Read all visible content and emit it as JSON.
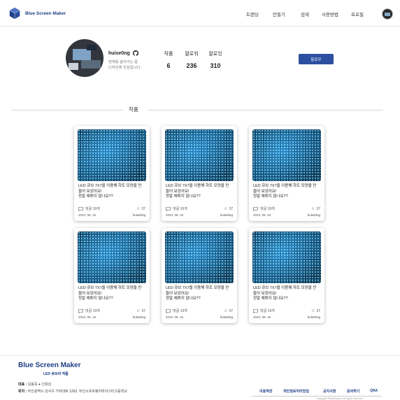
{
  "header": {
    "logo_text": "Blue Screen Maker",
    "nav": [
      "트렌딩",
      "만들기",
      "검색",
      "사용방법",
      "프로필"
    ]
  },
  "profile": {
    "username": "huise0ng",
    "bio_line1": "현재를 살아가는 중",
    "bio_line2": "디자인에 진심입니다.",
    "stats": [
      {
        "label": "작품",
        "value": "6"
      },
      {
        "label": "팔로워",
        "value": "236"
      },
      {
        "label": "팔로잉",
        "value": "310"
      }
    ],
    "follow_label": "팔로우"
  },
  "works": {
    "section_title": "작품",
    "cards": [
      {
        "title1": "LED 큐브 7X7을 이용해 하트 모양을 만",
        "title2": "들어 보았어요!",
        "title3": "정말 예쁘지 않나요??",
        "comments": "댓글 19개",
        "likes": "37",
        "date": "2023. 08. 19",
        "author": "huise0ng"
      },
      {
        "title1": "LED 큐브 7X7을 이용해 하트 모양을 만",
        "title2": "들어 보았어요!",
        "title3": "정말 예쁘지 않나요??",
        "comments": "댓글 19개",
        "likes": "37",
        "date": "2023. 08. 19",
        "author": "huise0ng"
      },
      {
        "title1": "LED 큐브 7X7을 이용해 하트 모양을 만",
        "title2": "들어 보았어요!",
        "title3": "정말 예쁘지 않나요??",
        "comments": "댓글 19개",
        "likes": "37",
        "date": "2023. 08. 19",
        "author": "huise0ng"
      },
      {
        "title1": "LED 큐브 7X7을 이용해 하트 모양을 만",
        "title2": "들어 보았어요!",
        "title3": "정말 예쁘지 않나요??",
        "comments": "댓글 19개",
        "likes": "37",
        "date": "2023. 08. 19",
        "author": "huise0ng"
      },
      {
        "title1": "LED 큐브 7X7을 이용해 하트 모양을 만",
        "title2": "들어 보았어요!",
        "title3": "정말 예쁘지 않나요??",
        "comments": "댓글 19개",
        "likes": "37",
        "date": "2023. 08. 19",
        "author": "huise0ng"
      },
      {
        "title1": "LED 큐브 7X7을 이용해 하트 모양을 만",
        "title2": "들어 보았어요!",
        "title3": "정말 예쁘지 않나요??",
        "comments": "댓글 19개",
        "likes": "37",
        "date": "2023. 08. 19",
        "author": "huise0ng"
      }
    ]
  },
  "footer": {
    "brand": "Blue Screen Maker",
    "sub": "LED 큐브의 작품",
    "ceo_label": "대표 :",
    "ceo_value": "김동욱 ● 신희성",
    "address_label": "위치 :",
    "address_value": "부산광역시 강서구 가락대로 1393, 부산소프트웨어마이스터고등학교",
    "links": [
      "이용약관",
      "개인정보처리방침",
      "공지사항",
      "문의하기",
      "QNA"
    ],
    "copyright": "Copyright ©BlueScreen. All rights reserved."
  },
  "colors": {
    "brand": "#1d3f86",
    "button": "#2c4f9f"
  }
}
